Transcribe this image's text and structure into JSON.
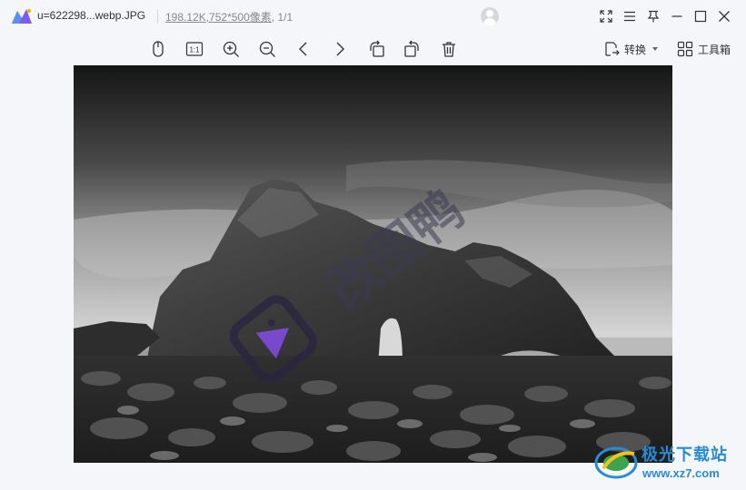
{
  "titlebar": {
    "file_name": "u=622298...webp.JPG",
    "file_size": "198.12K",
    "file_dims": ",752*500像素",
    "page_counter": ", 1/1"
  },
  "toolbar": {
    "tools": [
      "mouse-icon",
      "actual-size-icon",
      "zoom-in-icon",
      "zoom-out-icon",
      "previous-icon",
      "next-icon",
      "rotate-left-icon",
      "rotate-right-icon",
      "delete-icon"
    ],
    "actual_size_label": "1:1",
    "convert_label": "转换",
    "toolbox_label": "工具箱"
  },
  "image": {
    "watermark_text": "改图鸭"
  },
  "site_badge": {
    "name": "极光下载站",
    "url": "www.xz7.com"
  },
  "colors": {
    "accent": "#7b3cf5",
    "badge_blue": "#2a8bd5"
  }
}
